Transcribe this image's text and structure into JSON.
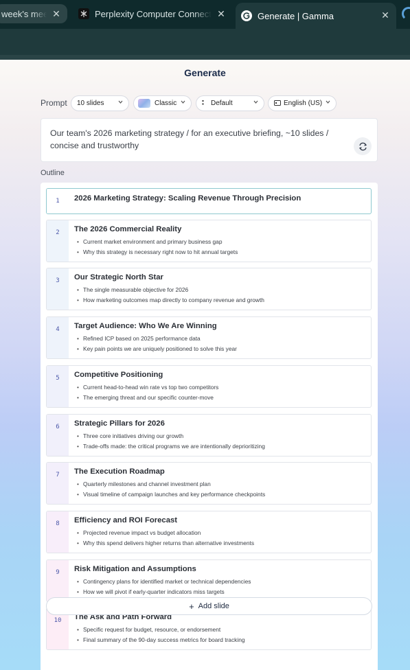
{
  "browser": {
    "tabs": [
      {
        "title": "week's mee",
        "active": false
      },
      {
        "title": "Perplexity Computer Connecto",
        "active": false
      },
      {
        "title": "Generate | Gamma",
        "active": true
      }
    ]
  },
  "page": {
    "title": "Generate",
    "prompt_label": "Prompt",
    "settings": {
      "slides": "10 slides",
      "theme": "Classic",
      "style": "Default",
      "language": "English (US)"
    },
    "prompt_text": "Our team's 2026 marketing strategy / for an executive briefing, ~10 slides / concise and trustworthy",
    "outline_label": "Outline",
    "add_slide_label": "Add slide"
  },
  "outline": [
    {
      "num": "1",
      "title": "2026 Marketing Strategy: Scaling Revenue Through Precision",
      "bullets": []
    },
    {
      "num": "2",
      "title": "The 2026 Commercial Reality",
      "bullets": [
        "Current market environment and primary business gap",
        "Why this strategy is necessary right now to hit annual targets"
      ]
    },
    {
      "num": "3",
      "title": "Our Strategic North Star",
      "bullets": [
        "The single measurable objective for 2026",
        "How marketing outcomes map directly to company revenue and growth"
      ]
    },
    {
      "num": "4",
      "title": "Target Audience: Who We Are Winning",
      "bullets": [
        "Refined ICP based on 2025 performance data",
        "Key pain points we are uniquely positioned to solve this year"
      ]
    },
    {
      "num": "5",
      "title": "Competitive Positioning",
      "bullets": [
        "Current head-to-head win rate vs top two competitors",
        "The emerging threat and our specific counter-move"
      ]
    },
    {
      "num": "6",
      "title": "Strategic Pillars for 2026",
      "bullets": [
        "Three core initiatives driving our growth",
        "Trade-offs made: the critical programs we are intentionally deprioritizing"
      ]
    },
    {
      "num": "7",
      "title": "The Execution Roadmap",
      "bullets": [
        "Quarterly milestones and channel investment plan",
        "Visual timeline of campaign launches and key performance checkpoints"
      ]
    },
    {
      "num": "8",
      "title": "Efficiency and ROI Forecast",
      "bullets": [
        "Projected revenue impact vs budget allocation",
        "Why this spend delivers higher returns than alternative investments"
      ]
    },
    {
      "num": "9",
      "title": "Risk Mitigation and Assumptions",
      "bullets": [
        "Contingency plans for identified market or technical dependencies",
        "How we will pivot if early-quarter indicators miss targets"
      ]
    },
    {
      "num": "10",
      "title": "The Ask and Path Forward",
      "bullets": [
        "Specific request for budget, resource, or endorsement",
        "Final summary of the 90-day success metrics for board tracking"
      ]
    }
  ],
  "colors": {
    "accent": "#4a56a8",
    "active_border": "#8ec8cf",
    "title_text": "#1b2b4a"
  }
}
